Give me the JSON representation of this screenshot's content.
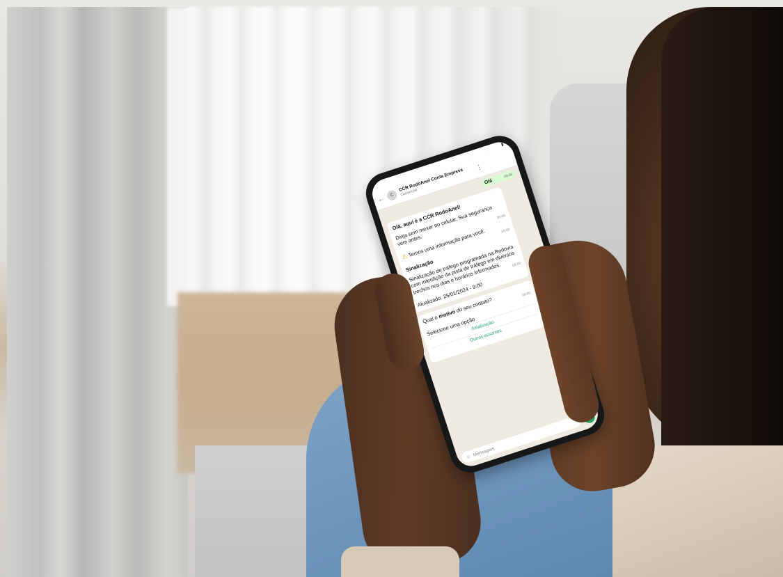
{
  "phone": {
    "status_time": "",
    "chat_name": "CCR RodoAnel Conta Empresa",
    "chat_sub": "Comercial",
    "out_message": "Olá",
    "out_time": "09:00",
    "greeting": "Olá, aqui é a CCR RodoAnel!",
    "intro": "Dirija sem mexer no celular. Sua segurança vem antes.",
    "intro_time": "09:00",
    "notice": "Temos uma informação para você.",
    "notice_time": "09:00",
    "section_title": "Sinalização",
    "section_body": "Sinalização de tráfego programada na Rodovia com interdição da pista de tráfego em diversos trechos nos dias e horários informados.",
    "section_time": "09:00",
    "updated": "Atualizado: 25/01/2024 - 9:00",
    "question_prefix": "Qual o",
    "question_bold": "motivo",
    "question_suffix": "do seu contato?",
    "question_time": "09:00",
    "select_prompt": "Selecione uma opção",
    "option_1": "Sinalização",
    "option_2": "Outros assuntos",
    "input_placeholder": "Mensagem"
  }
}
